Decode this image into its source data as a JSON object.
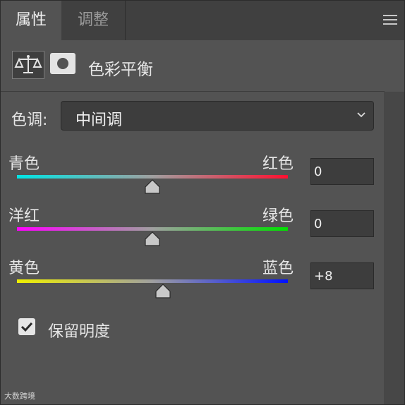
{
  "tabs": [
    {
      "label": "属性",
      "active": true
    },
    {
      "label": "调整",
      "active": false
    }
  ],
  "panel_menu_icon": "hamburger-menu-icon",
  "adjustment": {
    "icon": "balance-scale-icon",
    "mask_icon": "layer-mask-icon",
    "title": "色彩平衡"
  },
  "tone": {
    "label": "色调:",
    "selected": "中间调"
  },
  "sliders": [
    {
      "left_label": "青色",
      "right_label": "红色",
      "value": "0",
      "value_num": 0,
      "gradient": [
        "#00e5e5",
        "#a0a0a0",
        "#ff1030"
      ]
    },
    {
      "left_label": "洋红",
      "right_label": "绿色",
      "value": "0",
      "value_num": 0,
      "gradient": [
        "#ff00ff",
        "#a0a0a0",
        "#00e000"
      ]
    },
    {
      "left_label": "黄色",
      "right_label": "蓝色",
      "value": "+8",
      "value_num": 8,
      "gradient": [
        "#f0f000",
        "#a0a0a0",
        "#0010ff"
      ]
    }
  ],
  "preserve_luminosity": {
    "label": "保留明度",
    "checked": true
  },
  "watermark": "大数跨境",
  "colors": {
    "panel_bg": "#535353",
    "tabbar_bg": "#404040",
    "field_bg": "#3d3d3d"
  }
}
